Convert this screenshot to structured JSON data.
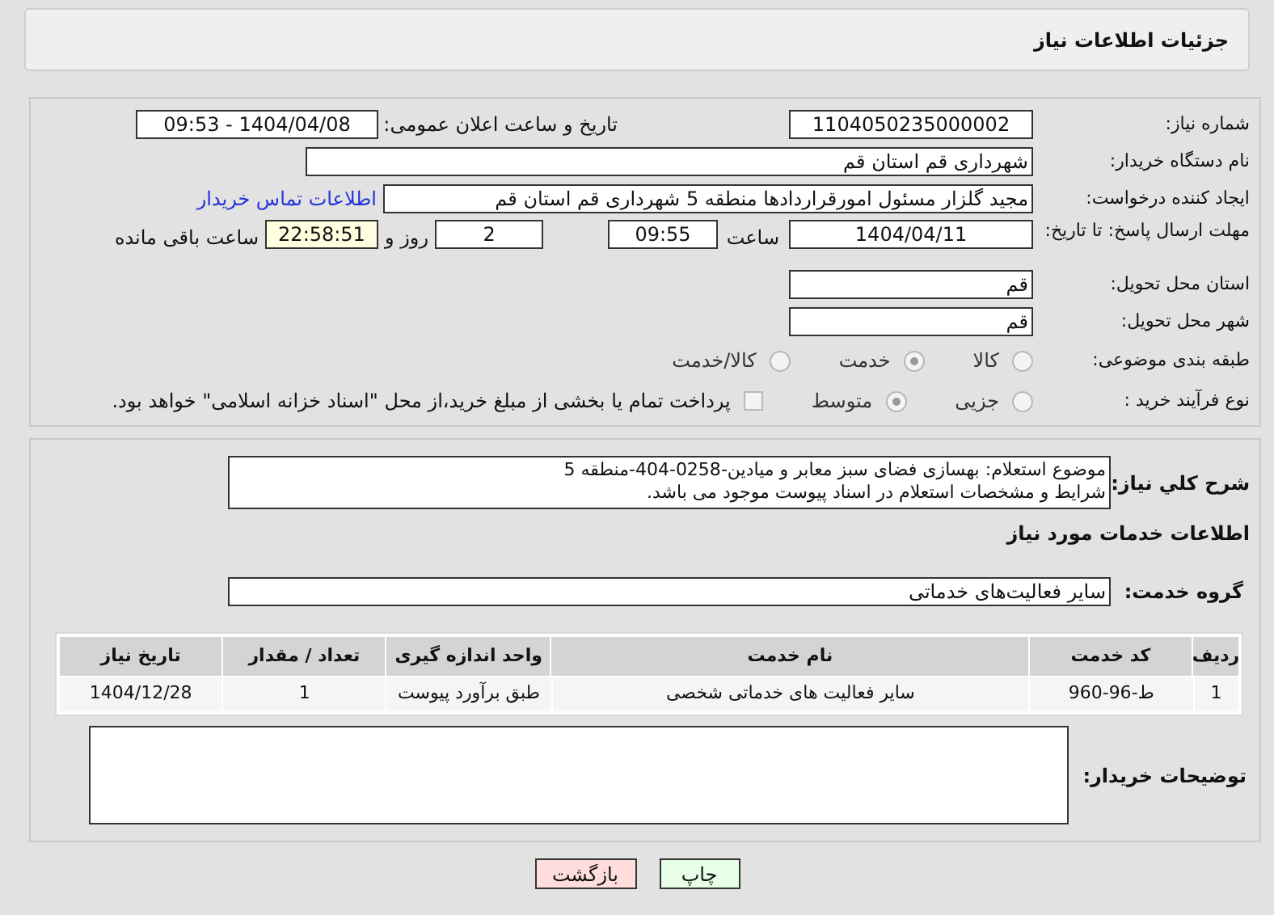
{
  "header": {
    "title": "جزئیات اطلاعات نیاز"
  },
  "need_number": {
    "label": "شماره نیاز:",
    "value": "1104050235000002"
  },
  "announce_date": {
    "label": "تاریخ و ساعت اعلان عمومی:",
    "value": "1404/04/08 - 09:53"
  },
  "buyer_org": {
    "label": "نام دستگاه خریدار:",
    "value": "شهرداری قم استان قم"
  },
  "requester": {
    "label": "ایجاد کننده درخواست:",
    "value": "مجید گلزار مسئول امورقراردادها منطقه 5 شهرداری قم استان قم",
    "link": "اطلاعات تماس خریدار"
  },
  "deadline": {
    "label": "مهلت ارسال پاسخ: تا تاریخ:",
    "date": "1404/04/11",
    "time_label": "ساعت",
    "time": "09:55",
    "days": "2",
    "days_label": "روز و",
    "remaining": "22:58:51",
    "remaining_label": "ساعت باقی مانده"
  },
  "province": {
    "label": "استان محل تحویل:",
    "value": "قم"
  },
  "city": {
    "label": "شهر محل تحویل:",
    "value": "قم"
  },
  "category": {
    "label": "طبقه بندی موضوعی:",
    "options": [
      {
        "label": "کالا",
        "selected": false
      },
      {
        "label": "خدمت",
        "selected": true
      },
      {
        "label": "کالا/خدمت",
        "selected": false
      }
    ]
  },
  "process": {
    "label": "نوع فرآیند خرید :",
    "options": [
      {
        "label": "جزیی",
        "selected": false
      },
      {
        "label": "متوسط",
        "selected": true
      }
    ],
    "payment": {
      "label": "پرداخت تمام یا بخشی از مبلغ خرید،از محل \"اسناد خزانه اسلامی\" خواهد بود.",
      "checked": false
    }
  },
  "description": {
    "label": "شرح کلي نياز:",
    "lines": [
      "موضوع استعلام: بهسازی فضای سبز معابر و میادین-0258-404-منطقه 5",
      "شرایط و مشخصات استعلام در اسناد پیوست موجود می باشد."
    ]
  },
  "services_title": "اطلاعات خدمات مورد نیاز",
  "service_group": {
    "label": "گروه خدمت:",
    "value": "سایر فعالیت‌های خدماتی"
  },
  "table": {
    "columns": [
      "ردیف",
      "کد خدمت",
      "نام خدمت",
      "واحد اندازه گیری",
      "تعداد / مقدار",
      "تاریخ نیاز"
    ],
    "rows": [
      [
        "1",
        "ط-96-960",
        "سایر فعالیت های خدماتی شخصی",
        "طبق برآورد پیوست",
        "1",
        "1404/12/28"
      ]
    ]
  },
  "buyer_notes": {
    "label": "توضیحات خریدار:"
  },
  "buttons": [
    {
      "label": "چاپ",
      "kind": "print"
    },
    {
      "label": "بازگشت",
      "kind": "back"
    }
  ]
}
